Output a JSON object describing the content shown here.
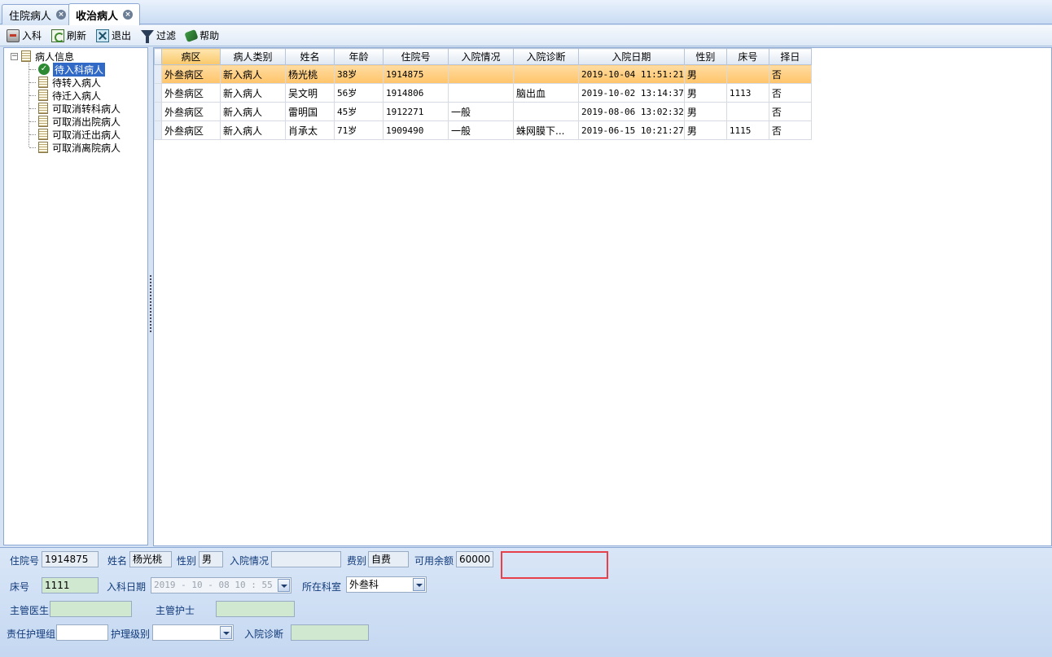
{
  "tabs": [
    {
      "label": "住院病人",
      "active": false
    },
    {
      "label": "收治病人",
      "active": true
    }
  ],
  "toolbar": {
    "admit": "入科",
    "refresh": "刷新",
    "exit": "退出",
    "filter": "过滤",
    "help": "帮助"
  },
  "tree": {
    "root": "病人信息",
    "items": [
      "待入科病人",
      "待转入病人",
      "待迁入病人",
      "可取消转科病人",
      "可取消出院病人",
      "可取消迁出病人",
      "可取消离院病人"
    ],
    "selected_index": 0
  },
  "grid": {
    "columns": [
      "病区",
      "病人类别",
      "姓名",
      "年龄",
      "住院号",
      "入院情况",
      "入院诊断",
      "入院日期",
      "性别",
      "床号",
      "择日"
    ],
    "sorted_column": 0,
    "selected_row": 0,
    "rows": [
      [
        "外叁病区",
        "新入病人",
        "杨光桃",
        "38岁",
        "1914875",
        "",
        "",
        "2019-10-04 11:51:21",
        "男",
        "",
        "否"
      ],
      [
        "外叁病区",
        "新入病人",
        "吴文明",
        "56岁",
        "1914806",
        "",
        "脑出血",
        "2019-10-02 13:14:37",
        "男",
        "1113",
        "否"
      ],
      [
        "外叁病区",
        "新入病人",
        "雷明国",
        "45岁",
        "1912271",
        "一般",
        "",
        "2019-08-06 13:02:32",
        "男",
        "",
        "否"
      ],
      [
        "外叁病区",
        "新入病人",
        "肖承太",
        "71岁",
        "1909490",
        "一般",
        "蛛网膜下...",
        "2019-06-15 10:21:27",
        "男",
        "1115",
        "否"
      ]
    ]
  },
  "detail": {
    "inpatient_no_label": "住院号",
    "inpatient_no": "1914875",
    "name_label": "姓名",
    "name": "杨光桃",
    "sex_label": "性别",
    "sex": "男",
    "admit_status_label": "入院情况",
    "admit_status": "",
    "fee_type_label": "费别",
    "fee_type": "自费",
    "balance_label": "可用余额",
    "balance": "60000",
    "bed_label": "床号",
    "bed": "1111",
    "admit_date_label": "入科日期",
    "admit_date": "2019 - 10 - 08   10 : 55",
    "dept_label": "所在科室",
    "dept": "外叁科",
    "doctor_label": "主管医生",
    "doctor": "",
    "nurse_label": "主管护士",
    "nurse": "",
    "nurse_group_label": "责任护理组",
    "nurse_group": "",
    "care_level_label": "护理级别",
    "care_level": "",
    "diagnosis_label": "入院诊断",
    "diagnosis": ""
  }
}
